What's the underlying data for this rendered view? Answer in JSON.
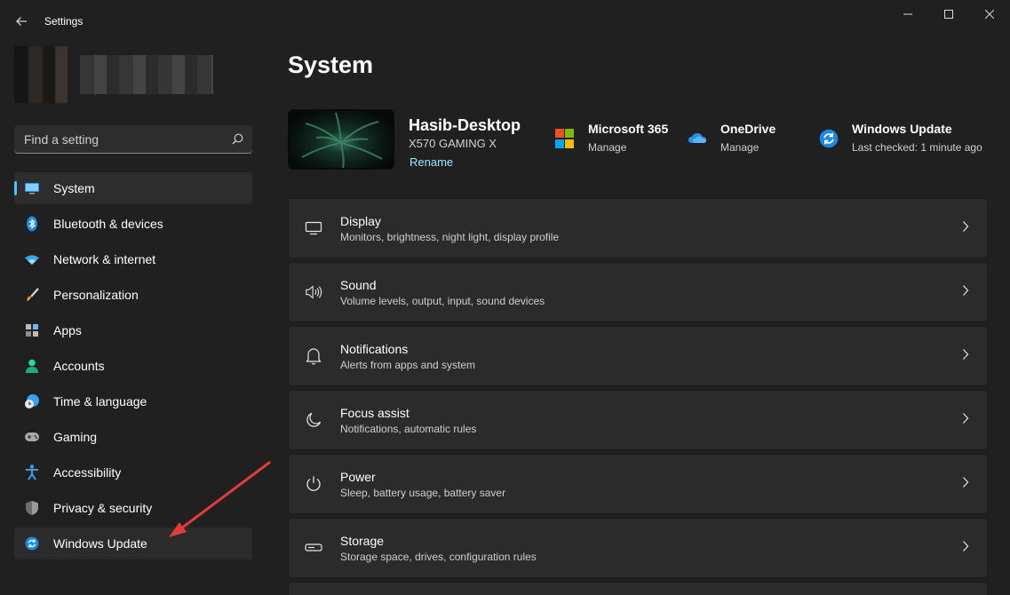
{
  "window": {
    "title": "Settings"
  },
  "search": {
    "placeholder": "Find a setting"
  },
  "sidebar": {
    "items": [
      {
        "label": "System",
        "icon": "monitor-icon",
        "active": true
      },
      {
        "label": "Bluetooth & devices",
        "icon": "bluetooth-icon"
      },
      {
        "label": "Network & internet",
        "icon": "wifi-icon"
      },
      {
        "label": "Personalization",
        "icon": "brush-icon"
      },
      {
        "label": "Apps",
        "icon": "apps-icon"
      },
      {
        "label": "Accounts",
        "icon": "person-icon"
      },
      {
        "label": "Time & language",
        "icon": "clock-globe-icon"
      },
      {
        "label": "Gaming",
        "icon": "gamepad-icon"
      },
      {
        "label": "Accessibility",
        "icon": "accessibility-icon"
      },
      {
        "label": "Privacy & security",
        "icon": "shield-icon"
      },
      {
        "label": "Windows Update",
        "icon": "update-icon"
      }
    ]
  },
  "main": {
    "title": "System",
    "device": {
      "name": "Hasib-Desktop",
      "model": "X570 GAMING X",
      "rename_label": "Rename"
    },
    "quick_links": [
      {
        "title": "Microsoft 365",
        "sub": "Manage",
        "icon": "microsoft-logo-icon"
      },
      {
        "title": "OneDrive",
        "sub": "Manage",
        "icon": "onedrive-cloud-icon"
      },
      {
        "title": "Windows Update",
        "sub": "Last checked: 1 minute ago",
        "icon": "update-icon"
      }
    ],
    "cards": [
      {
        "title": "Display",
        "sub": "Monitors, brightness, night light, display profile",
        "icon": "display-icon"
      },
      {
        "title": "Sound",
        "sub": "Volume levels, output, input, sound devices",
        "icon": "speaker-icon"
      },
      {
        "title": "Notifications",
        "sub": "Alerts from apps and system",
        "icon": "bell-icon"
      },
      {
        "title": "Focus assist",
        "sub": "Notifications, automatic rules",
        "icon": "moon-icon"
      },
      {
        "title": "Power",
        "sub": "Sleep, battery usage, battery saver",
        "icon": "power-icon"
      },
      {
        "title": "Storage",
        "sub": "Storage space, drives, configuration rules",
        "icon": "storage-drive-icon"
      }
    ]
  },
  "colors": {
    "accent": "#4cc2ff",
    "link": "#99ebff",
    "background": "#202020",
    "card": "#2b2b2b",
    "annotation_arrow": "#e23b3b"
  }
}
